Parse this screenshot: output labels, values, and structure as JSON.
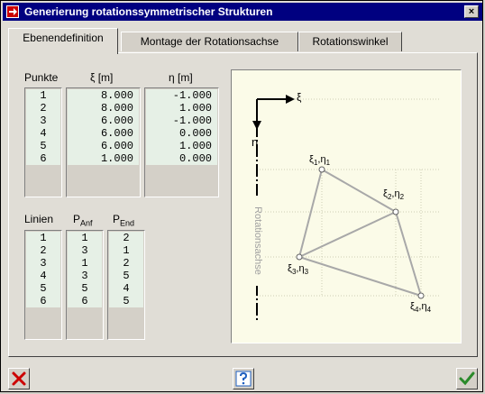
{
  "window": {
    "title": "Generierung rotationssymmetrischer Strukturen",
    "close_glyph": "×"
  },
  "tabs": [
    {
      "label": "Ebenendefinition",
      "active": true
    },
    {
      "label": "Montage der Rotationsachse",
      "active": false
    },
    {
      "label": "Rotationswinkel",
      "active": false
    }
  ],
  "points": {
    "headers": {
      "nr": "Punkte",
      "xi": "ξ [m]",
      "eta": "η [m]"
    },
    "nr": [
      "1",
      "2",
      "3",
      "4",
      "5",
      "6"
    ],
    "xi": [
      "8.000",
      "8.000",
      "6.000",
      "6.000",
      "6.000",
      "1.000"
    ],
    "eta": [
      "-1.000",
      "1.000",
      "-1.000",
      "0.000",
      "1.000",
      "0.000"
    ]
  },
  "lines": {
    "headers": {
      "nr": "Linien",
      "p_anf": "P",
      "p_anf_sub": "Anf",
      "p_end": "P",
      "p_end_sub": "End"
    },
    "nr": [
      "1",
      "2",
      "3",
      "4",
      "5",
      "6"
    ],
    "p_anf": [
      "1",
      "3",
      "1",
      "3",
      "5",
      "6"
    ],
    "p_end": [
      "2",
      "1",
      "2",
      "5",
      "4",
      "5"
    ]
  },
  "diagram": {
    "xi_axis": "ξ",
    "eta_axis": "η",
    "axis_label": "Rotationsachse",
    "p1": {
      "a": "ξ",
      "as": "1",
      "b": ",η",
      "bs": "1"
    },
    "p2": {
      "a": "ξ",
      "as": "2",
      "b": ",η",
      "bs": "2"
    },
    "p3": {
      "a": "ξ",
      "as": "3",
      "b": ",η",
      "bs": "3"
    },
    "p4": {
      "a": "ξ",
      "as": "4",
      "b": ",η",
      "bs": "4"
    }
  },
  "colors": {
    "title_bar": "#000080",
    "cancel": "#cc0000",
    "ok": "#2a8a2a",
    "help": "#2060c0"
  },
  "buttons": {
    "cancel_icon": "cancel-icon",
    "help_icon": "help-icon",
    "ok_icon": "ok-icon"
  }
}
